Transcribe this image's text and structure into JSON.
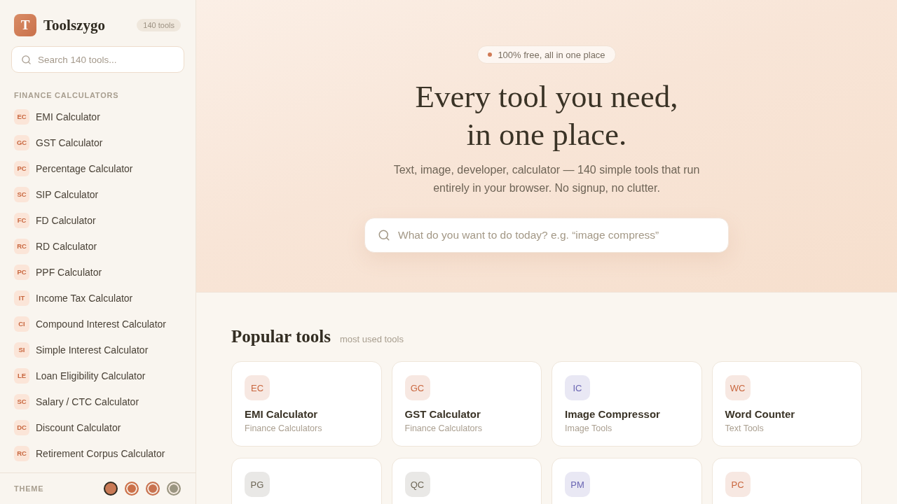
{
  "sidebar": {
    "logo": {
      "letter": "T",
      "name": "Toolszygo"
    },
    "count_badge": "140 tools",
    "search": {
      "placeholder": "Search 140 tools..."
    },
    "sections": [
      {
        "title": "FINANCE CALCULATORS",
        "items": [
          {
            "abbr": "EC",
            "label": "EMI Calculator"
          },
          {
            "abbr": "GC",
            "label": "GST Calculator"
          },
          {
            "abbr": "PC",
            "label": "Percentage Calculator"
          },
          {
            "abbr": "SC",
            "label": "SIP Calculator"
          },
          {
            "abbr": "FC",
            "label": "FD Calculator"
          },
          {
            "abbr": "RC",
            "label": "RD Calculator"
          },
          {
            "abbr": "PC",
            "label": "PPF Calculator"
          },
          {
            "abbr": "IT",
            "label": "Income Tax Calculator"
          },
          {
            "abbr": "CI",
            "label": "Compound Interest Calculator"
          },
          {
            "abbr": "SI",
            "label": "Simple Interest Calculator"
          },
          {
            "abbr": "LE",
            "label": "Loan Eligibility Calculator"
          },
          {
            "abbr": "SC",
            "label": "Salary / CTC Calculator"
          },
          {
            "abbr": "DC",
            "label": "Discount Calculator"
          },
          {
            "abbr": "RC",
            "label": "Retirement Corpus Calculator"
          }
        ]
      }
    ],
    "theme": {
      "label": "THEME",
      "swatches": [
        {
          "color": "#c97a56",
          "selected": true
        },
        {
          "color": "#cb7049",
          "selected": false
        },
        {
          "color": "#c87250",
          "selected": false
        },
        {
          "color": "#9a9581",
          "selected": false
        }
      ]
    }
  },
  "hero": {
    "badge": "100% free, all in one place",
    "title": "Every tool you need, in one place.",
    "subtitle": "Text, image, developer, calculator — 140 simple tools that run entirely in your browser. No signup, no clutter.",
    "search": {
      "placeholder": "What do you want to do today? e.g. “image compress”"
    }
  },
  "popular": {
    "title": "Popular tools",
    "subtitle": "most used tools",
    "cards": [
      {
        "abbr": "EC",
        "color": "#c9673f",
        "name": "EMI Calculator",
        "category": "Finance Calculators"
      },
      {
        "abbr": "GC",
        "color": "#c9673f",
        "name": "GST Calculator",
        "category": "Finance Calculators"
      },
      {
        "abbr": "IC",
        "color": "#6a65b3",
        "name": "Image Compressor",
        "category": "Image Tools"
      },
      {
        "abbr": "WC",
        "color": "#c9673f",
        "name": "Word Counter",
        "category": "Text Tools"
      },
      {
        "abbr": "PG",
        "color": "#6d6656"
      },
      {
        "abbr": "QC",
        "color": "#6d6656"
      },
      {
        "abbr": "PM",
        "color": "#6a65b3"
      },
      {
        "abbr": "PC",
        "color": "#c9673f"
      }
    ]
  }
}
